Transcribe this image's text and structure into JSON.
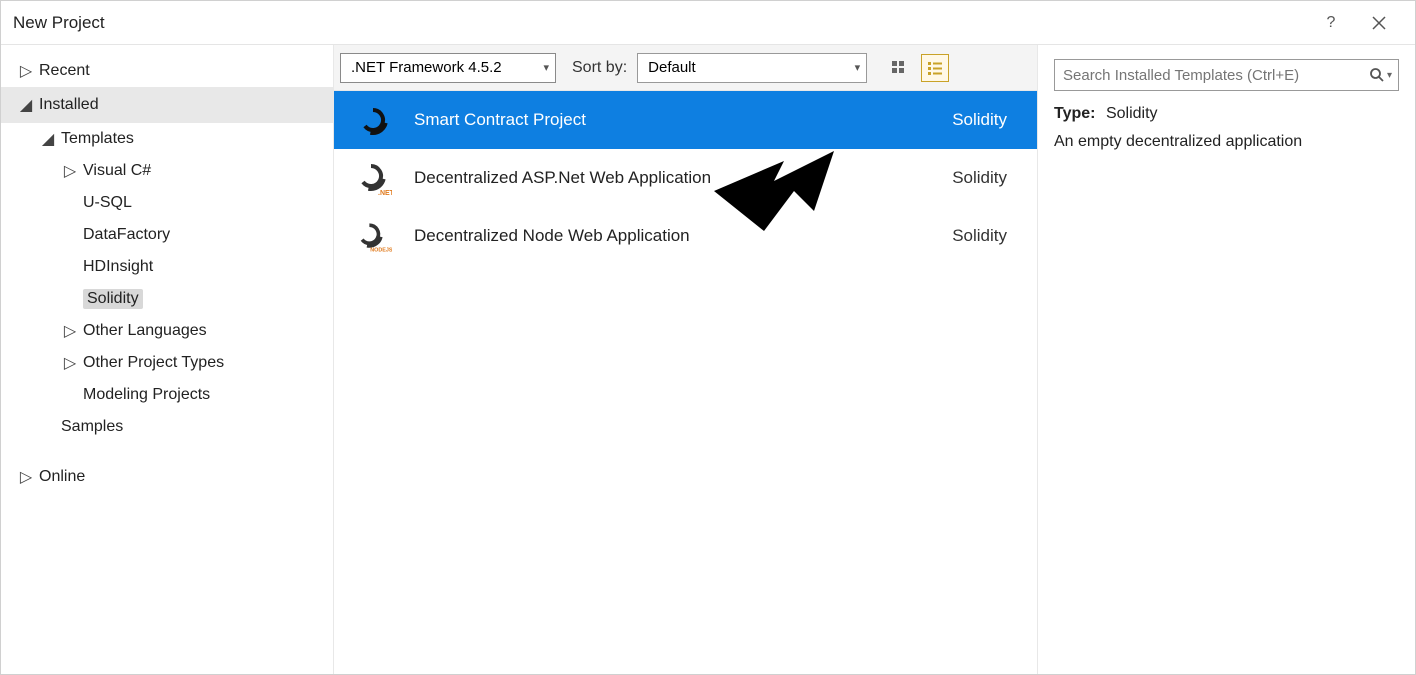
{
  "title": "New Project",
  "toolbar": {
    "framework": ".NET Framework 4.5.2",
    "sort_by_label": "Sort by:",
    "sort_value": "Default",
    "search_placeholder": "Search Installed Templates (Ctrl+E)"
  },
  "tree": {
    "recent": "Recent",
    "installed": "Installed",
    "templates": "Templates",
    "visual_csharp": "Visual C#",
    "usql": "U-SQL",
    "datafactory": "DataFactory",
    "hdinsight": "HDInsight",
    "solidity": "Solidity",
    "other_languages": "Other Languages",
    "other_project_types": "Other Project Types",
    "modeling_projects": "Modeling Projects",
    "samples": "Samples",
    "online": "Online"
  },
  "templates_list": [
    {
      "name": "Smart Contract Project",
      "language": "Solidity",
      "selected": true,
      "badge": ""
    },
    {
      "name": "Decentralized ASP.Net Web Application",
      "language": "Solidity",
      "selected": false,
      "badge": ".NET"
    },
    {
      "name": "Decentralized Node Web Application",
      "language": "Solidity",
      "selected": false,
      "badge": "NODEJS"
    }
  ],
  "details": {
    "type_label": "Type:",
    "type_value": "Solidity",
    "description": "An empty decentralized application"
  }
}
